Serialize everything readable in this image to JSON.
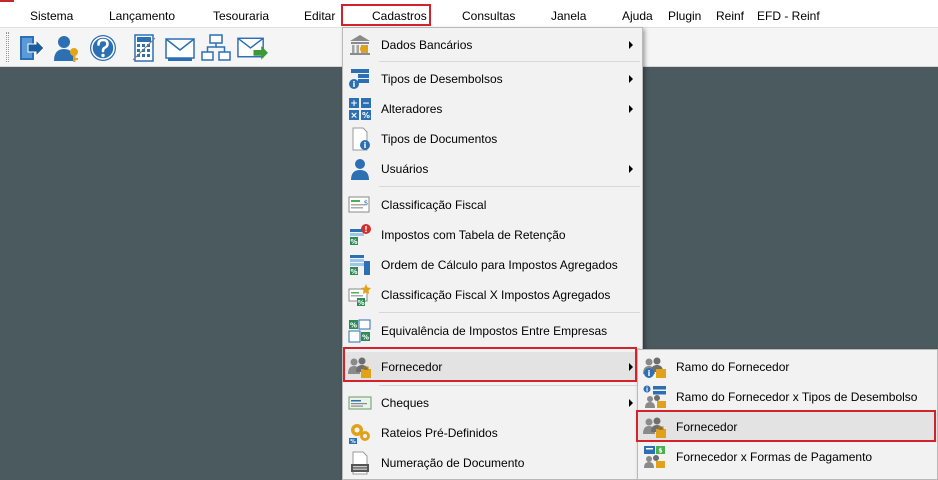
{
  "menubar": {
    "items": [
      "Sistema",
      "Lançamento",
      "Tesouraria",
      "Editar",
      "Cadastros",
      "Consultas",
      "Janela",
      "Ajuda",
      "Plugin",
      "Reinf",
      "EFD - Reinf"
    ]
  },
  "toolbar": {
    "buttons": [
      "exit-icon",
      "user-key-icon",
      "help-icon",
      "calculator-icon",
      "envelope-icon",
      "network-icon",
      "forward-mail-icon"
    ]
  },
  "cadastros_menu": {
    "items": [
      {
        "label": "Dados Bancários",
        "icon": "bank-icon",
        "submenu": true
      },
      {
        "label": "Tipos de Desembolsos",
        "icon": "disbursement-types-icon",
        "submenu": true
      },
      {
        "label": "Alteradores",
        "icon": "calculator-percent-icon",
        "submenu": true
      },
      {
        "label": "Tipos de Documentos",
        "icon": "document-info-icon",
        "submenu": false
      },
      {
        "label": "Usuários",
        "icon": "user-icon",
        "submenu": true
      },
      {
        "label": "Classificação Fiscal",
        "icon": "fiscal-classification-icon",
        "submenu": false
      },
      {
        "label": "Impostos com Tabela de Retenção",
        "icon": "tax-retention-icon",
        "submenu": false
      },
      {
        "label": "Ordem de Cálculo para Impostos Agregados",
        "icon": "calc-order-icon",
        "submenu": false
      },
      {
        "label": "Classificação Fiscal X Impostos Agregados",
        "icon": "fiscal-tax-icon",
        "submenu": false
      },
      {
        "label": "Equivalência de Impostos Entre Empresas",
        "icon": "tax-equivalence-icon",
        "submenu": false
      },
      {
        "label": "Fornecedor",
        "icon": "supplier-icon",
        "submenu": true
      },
      {
        "label": "Cheques",
        "icon": "check-icon",
        "submenu": true
      },
      {
        "label": "Rateios Pré-Definidos",
        "icon": "apportionment-icon",
        "submenu": false
      },
      {
        "label": "Numeração de Documento",
        "icon": "document-numbering-icon",
        "submenu": false
      }
    ]
  },
  "fornecedor_submenu": {
    "items": [
      {
        "label": "Ramo do Fornecedor",
        "icon": "supplier-branch-icon"
      },
      {
        "label": "Ramo do Fornecedor x Tipos de Desembolso",
        "icon": "supplier-branch-disbursement-icon"
      },
      {
        "label": "Fornecedor",
        "icon": "supplier-icon"
      },
      {
        "label": "Fornecedor x Formas de Pagamento",
        "icon": "supplier-payment-icon"
      }
    ]
  },
  "colors": {
    "highlight_border": "#d3222a",
    "workspace": "#4a5a5e",
    "menu_bg": "#f2f2f2",
    "hover_bg": "#e3e3e3"
  }
}
